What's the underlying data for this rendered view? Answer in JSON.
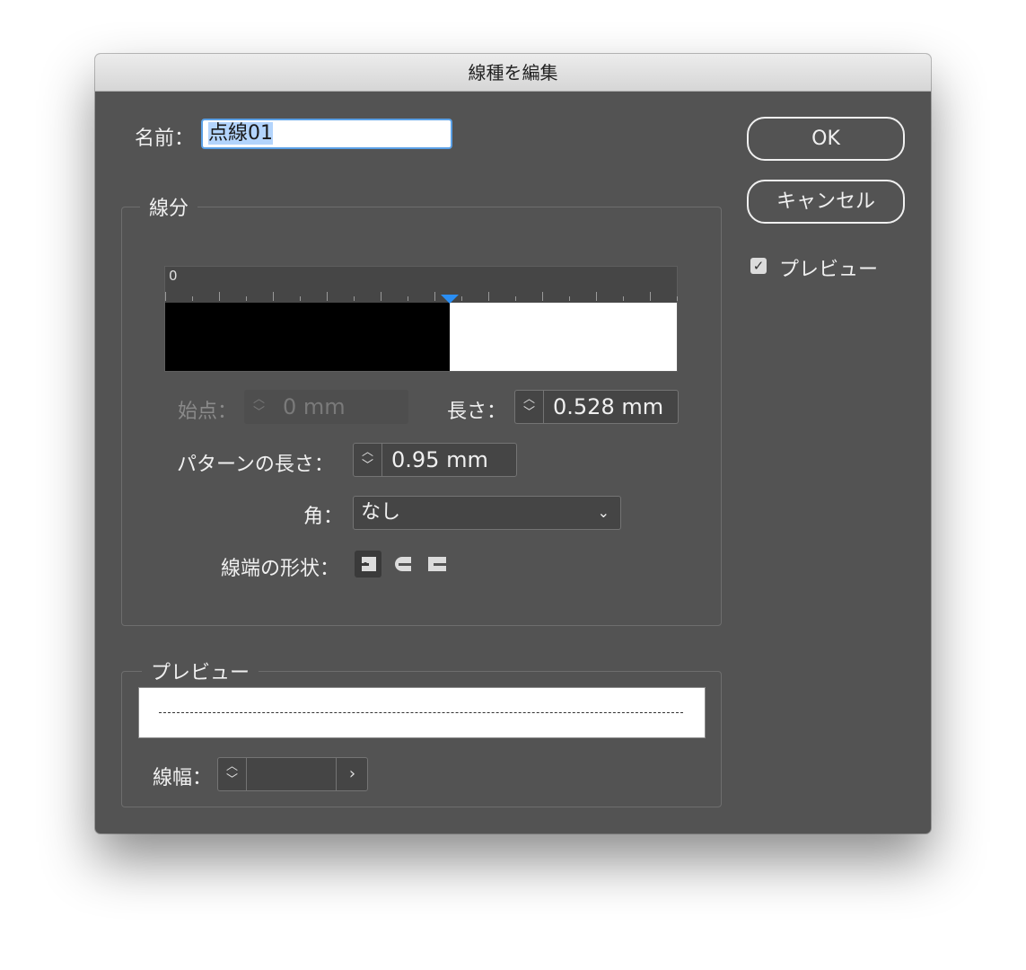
{
  "window": {
    "title": "線種を編集"
  },
  "name_field": {
    "label": "名前：",
    "value": "点線01"
  },
  "buttons": {
    "ok": "OK",
    "cancel": "キャンセル"
  },
  "preview_checkbox": {
    "label": "プレビュー",
    "checked": true
  },
  "segment_group": {
    "title": "線分",
    "ruler_zero": "0",
    "start": {
      "label": "始点：",
      "value": "0 mm",
      "enabled": false
    },
    "length": {
      "label": "長さ：",
      "value": "0.528 mm"
    },
    "pattern_length": {
      "label": "パターンの長さ：",
      "value": "0.95 mm"
    },
    "corner": {
      "label": "角：",
      "value": "なし"
    },
    "cap_shape": {
      "label": "線端の形状：",
      "selected": "butt",
      "options": [
        "butt",
        "round",
        "projecting"
      ]
    },
    "dash_fraction": 0.556
  },
  "preview_group": {
    "title": "プレビュー",
    "stroke_width": {
      "label": "線幅：",
      "value": ""
    }
  },
  "colors": {
    "dialog_bg": "#535353",
    "accent": "#2a8ef4",
    "focus": "#5aa0e6"
  }
}
